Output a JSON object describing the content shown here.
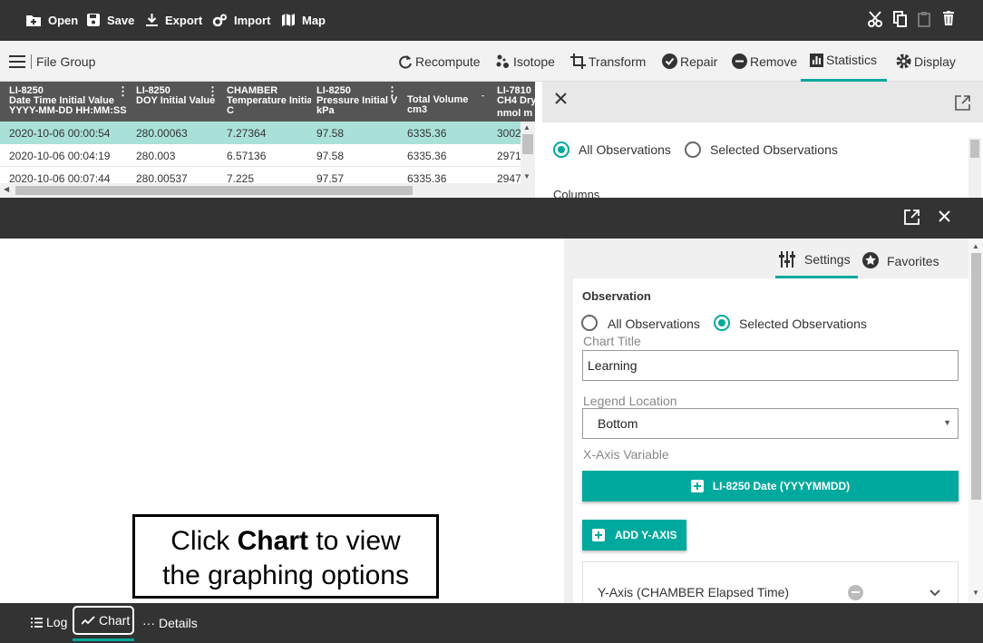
{
  "toolbar": {
    "open": "Open",
    "save": "Save",
    "export": "Export",
    "import": "Import",
    "map": "Map",
    "right_icons": [
      "scissors-icon",
      "copy-icon",
      "clipboard-icon",
      "trash-icon"
    ]
  },
  "secondary": {
    "file_group": "File Group",
    "recompute": "Recompute",
    "isotope": "Isotope",
    "transform": "Transform",
    "repair": "Repair",
    "remove": "Remove",
    "statistics": "Statistics",
    "display": "Display"
  },
  "table": {
    "columns": [
      {
        "line1": "LI-8250",
        "line2": "Date Time Initial Value",
        "line3": "YYYY-MM-DD HH:MM:SS"
      },
      {
        "line1": "LI-8250",
        "line2": "DOY Initial Value",
        "line3": ""
      },
      {
        "line1": "CHAMBER",
        "line2": "Temperature Initial",
        "line3": "C"
      },
      {
        "line1": "LI-8250",
        "line2": "Pressure Initial V",
        "line3": "kPa"
      },
      {
        "line1": "",
        "line2": "Total Volume",
        "line3": "cm3"
      },
      {
        "line1": "LI-7810",
        "line2": "CH4 Dry",
        "line3": "nmol m"
      }
    ],
    "rows": [
      [
        "2020-10-06 00:00:54",
        "280.00063",
        "7.27364",
        "97.58",
        "6335.36",
        "3002"
      ],
      [
        "2020-10-06 00:04:19",
        "280.003",
        "6.57136",
        "97.58",
        "6335.36",
        "2971"
      ],
      [
        "2020-10-06 00:07:44",
        "280.00537",
        "7.225",
        "97.57",
        "6335.36",
        "2947"
      ]
    ]
  },
  "stats_panel": {
    "all_obs": "All Observations",
    "selected_obs": "Selected Observations",
    "columns": "Columns"
  },
  "settings": {
    "tab_settings": "Settings",
    "tab_favorites": "Favorites",
    "observation_heading": "Observation",
    "all_obs": "All Observations",
    "selected_obs": "Selected Observations",
    "chart_title_label": "Chart Title",
    "chart_title_value": "Learning",
    "legend_location_label": "Legend Location",
    "legend_location_value": "Bottom",
    "x_axis_label": "X-Axis Variable",
    "x_axis_button": "LI-8250 Date (YYYYMMDD)",
    "add_y_axis": "ADD Y-AXIS",
    "y_axis_item": "Y-Axis (CHAMBER Elapsed Time)"
  },
  "bottom": {
    "log": "Log",
    "chart": "Chart",
    "details": "Details"
  },
  "callout": {
    "part1": "Click ",
    "bold": "Chart",
    "part2": " to view",
    "line2": "the graphing options"
  },
  "colors": {
    "accent": "#00a99d",
    "dark_bar": "#333333",
    "selected_row": "#a9e1d8"
  }
}
